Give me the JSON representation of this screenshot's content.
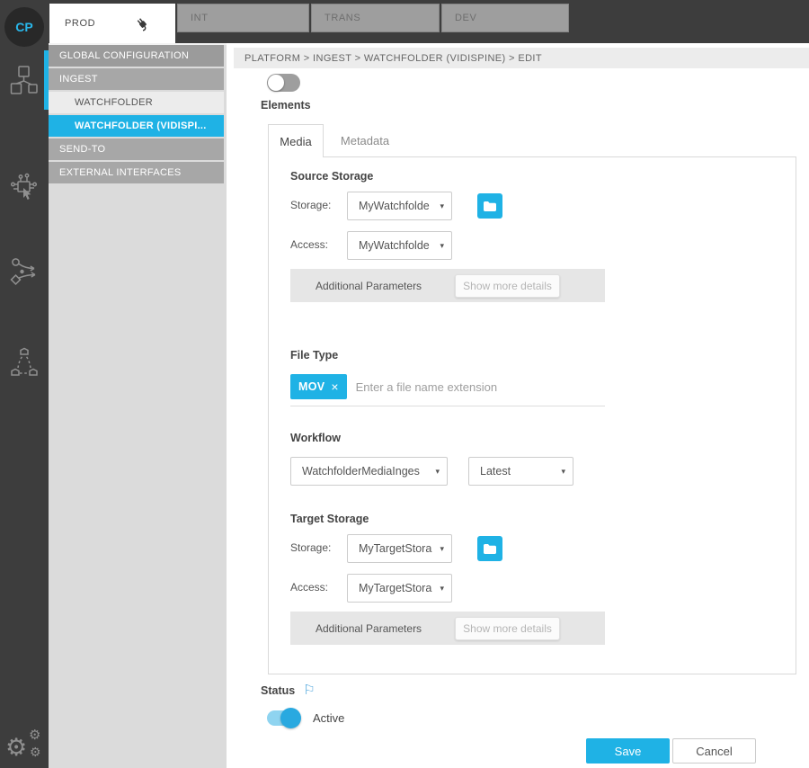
{
  "ui": {
    "caret": "▾",
    "close_glyph": "×",
    "flag_glyph": "⚐",
    "gear_glyph": "⚙"
  },
  "accent_color": "#1fb2e5",
  "sidebar": {
    "avatar_label": "CP",
    "icons": [
      "modules-icon",
      "automation-icon",
      "routing-icon",
      "cluster-icon",
      "settings-gears-icon"
    ]
  },
  "topbar": {
    "tabs": [
      {
        "label": "PROD",
        "active": true
      },
      {
        "label": "INT",
        "active": false
      },
      {
        "label": "TRANS",
        "active": false
      },
      {
        "label": "DEV",
        "active": false
      }
    ]
  },
  "nav": {
    "items": [
      {
        "label": "GLOBAL CONFIGURATION",
        "level": 0,
        "selected": false
      },
      {
        "label": "INGEST",
        "level": 0,
        "selected": false
      },
      {
        "label": "WATCHFOLDER",
        "level": 1,
        "selected": false
      },
      {
        "label": "WATCHFOLDER (VIDISPI...",
        "level": 1,
        "selected": true
      },
      {
        "label": "SEND-TO",
        "level": 0,
        "selected": false
      },
      {
        "label": "EXTERNAL INTERFACES",
        "level": 0,
        "selected": false
      }
    ]
  },
  "main": {
    "breadcrumb": "PLATFORM > INGEST > WATCHFOLDER (VIDISPINE) > EDIT",
    "top_toggle_state": "off",
    "elements_label": "Elements",
    "tabs": {
      "media": "Media",
      "metadata": "Metadata",
      "active": "Media"
    },
    "source_storage": {
      "title": "Source Storage",
      "storage_label": "Storage:",
      "storage_value": "MyWatchfolde",
      "access_label": "Access:",
      "access_value": "MyWatchfolde",
      "additional_parameters": "Additional Parameters",
      "show_more": "Show more details"
    },
    "file_type": {
      "title": "File Type",
      "tag": "MOV",
      "placeholder": "Enter a file name extension"
    },
    "workflow": {
      "title": "Workflow",
      "value": "WatchfolderMediaInges",
      "version": "Latest"
    },
    "target_storage": {
      "title": "Target Storage",
      "storage_label": "Storage:",
      "storage_value": "MyTargetStora",
      "access_label": "Access:",
      "access_value": "MyTargetStora",
      "additional_parameters": "Additional Parameters",
      "show_more": "Show more details"
    },
    "status": {
      "title": "Status",
      "toggle_label": "Active",
      "toggle_state": "on"
    },
    "actions": {
      "save": "Save",
      "cancel": "Cancel"
    }
  }
}
